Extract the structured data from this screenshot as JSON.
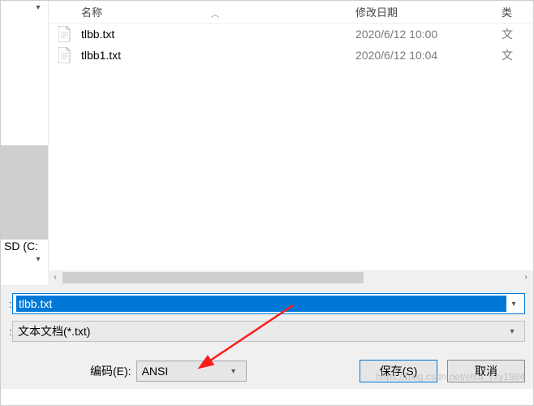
{
  "sidebar": {
    "drive_label": "SD (C:"
  },
  "headers": {
    "name": "名称",
    "date": "修改日期",
    "type": "类"
  },
  "files": [
    {
      "name": "tlbb.txt",
      "date": "2020/6/12 10:00",
      "type": "文"
    },
    {
      "name": "tlbb1.txt",
      "date": "2020/6/12 10:04",
      "type": "文"
    }
  ],
  "filename": {
    "value": "tlbb.txt"
  },
  "filetype": {
    "value": "文本文档(*.txt)"
  },
  "encoding": {
    "label": "编码(E):",
    "value": "ANSI"
  },
  "buttons": {
    "save": "保存(S)",
    "cancel": "取消"
  },
  "watermark": "https://blog.csdn.net/elsa_yxy1984"
}
